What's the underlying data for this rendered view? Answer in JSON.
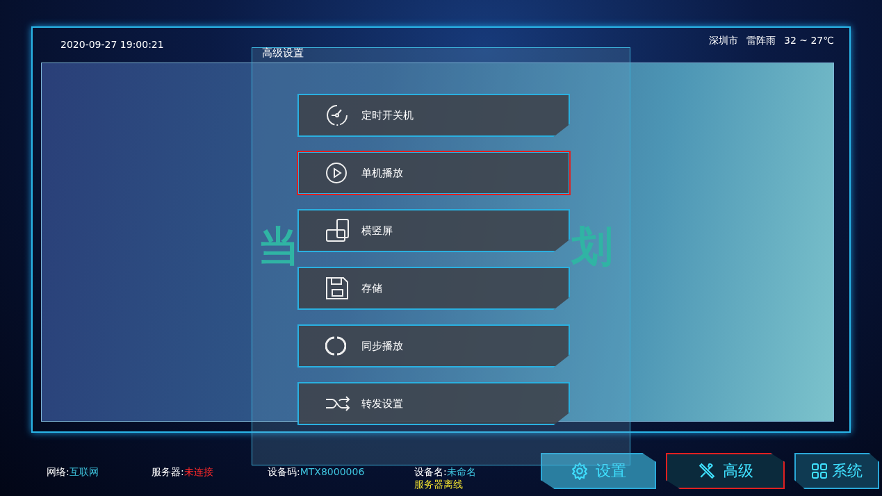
{
  "datetime": "2020-09-27 19:00:21",
  "weather": {
    "city": "深圳市",
    "condition": "雷阵雨",
    "temperature": "32 ~ 27℃"
  },
  "background_message": [
    "当",
    "划"
  ],
  "panel": {
    "title": "高级设置",
    "items": [
      {
        "label": "定时开关机",
        "selected": false
      },
      {
        "label": "单机播放",
        "selected": true
      },
      {
        "label": "横竖屏",
        "selected": false
      },
      {
        "label": "存储",
        "selected": false
      },
      {
        "label": "同步播放",
        "selected": false
      },
      {
        "label": "转发设置",
        "selected": false
      }
    ]
  },
  "status": [
    {
      "label": "网络:",
      "value": "互联网",
      "color": "#3fc6e0"
    },
    {
      "label": "服务器:",
      "value": "未连接",
      "color": "#ff2a2a"
    },
    {
      "label": "设备码:",
      "value": "MTX8000006",
      "color": "#3fc6e0"
    },
    {
      "label": "设备名:",
      "value": "未命名",
      "color": "#3fc6e0",
      "note": "服务器离线"
    }
  ],
  "tabs": [
    {
      "label": "设置",
      "selected": false
    },
    {
      "label": "高级",
      "selected": true
    },
    {
      "label": "系统",
      "selected": false
    }
  ]
}
